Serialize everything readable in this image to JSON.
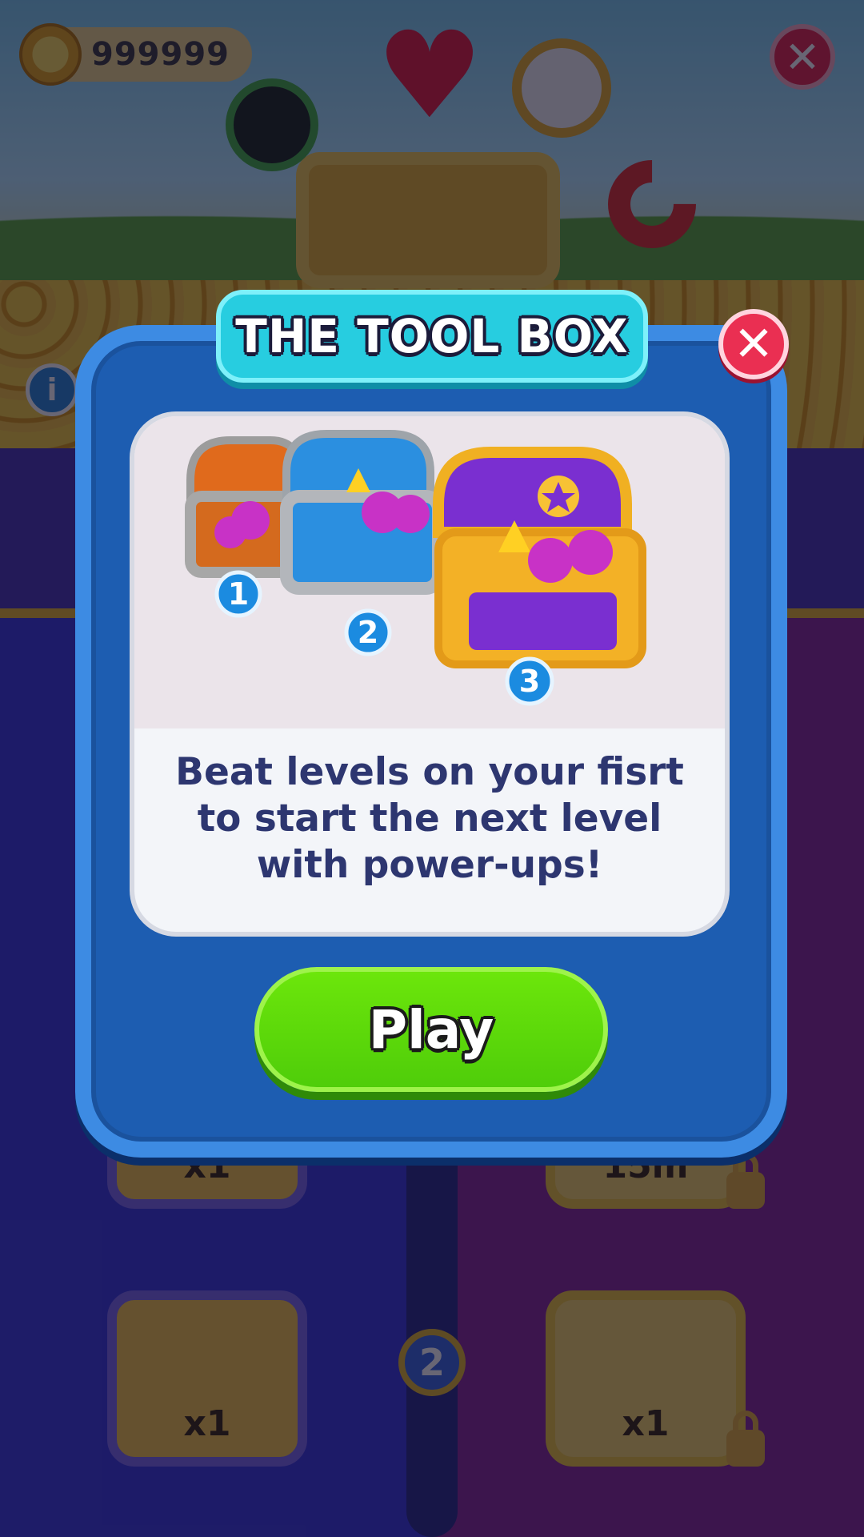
{
  "hud": {
    "coins": "999999",
    "close_icon": "close-icon",
    "icons": [
      "coin-icon",
      "fullscreen-icon",
      "infinite-heart-icon",
      "compass-icon",
      "magnet-icon",
      "info-icon"
    ]
  },
  "background": {
    "tiles": [
      {
        "label": "x1",
        "side": "left"
      },
      {
        "label": "15m",
        "side": "right",
        "locked": true
      },
      {
        "label": "x1",
        "side": "left"
      },
      {
        "label": "x1",
        "side": "right",
        "locked": true
      }
    ],
    "step": "2",
    "info": "i"
  },
  "modal": {
    "title": "THE TOOL BOX",
    "close": "✕",
    "chests": [
      {
        "badge": "1",
        "color": "#e06a1c"
      },
      {
        "badge": "2",
        "color": "#2b8fe0"
      },
      {
        "badge": "3",
        "color": "#7a2fd0"
      }
    ],
    "message_lines": [
      "Beat levels on your fisrt",
      "to start the next level",
      "with power-ups!"
    ],
    "play_label": "Play"
  },
  "colors": {
    "title_bg": "#27cde0",
    "modal_bg": "#1d5db1",
    "play_button": "#58d90a",
    "close_button": "#ea2f52",
    "text": "#2d3670"
  }
}
